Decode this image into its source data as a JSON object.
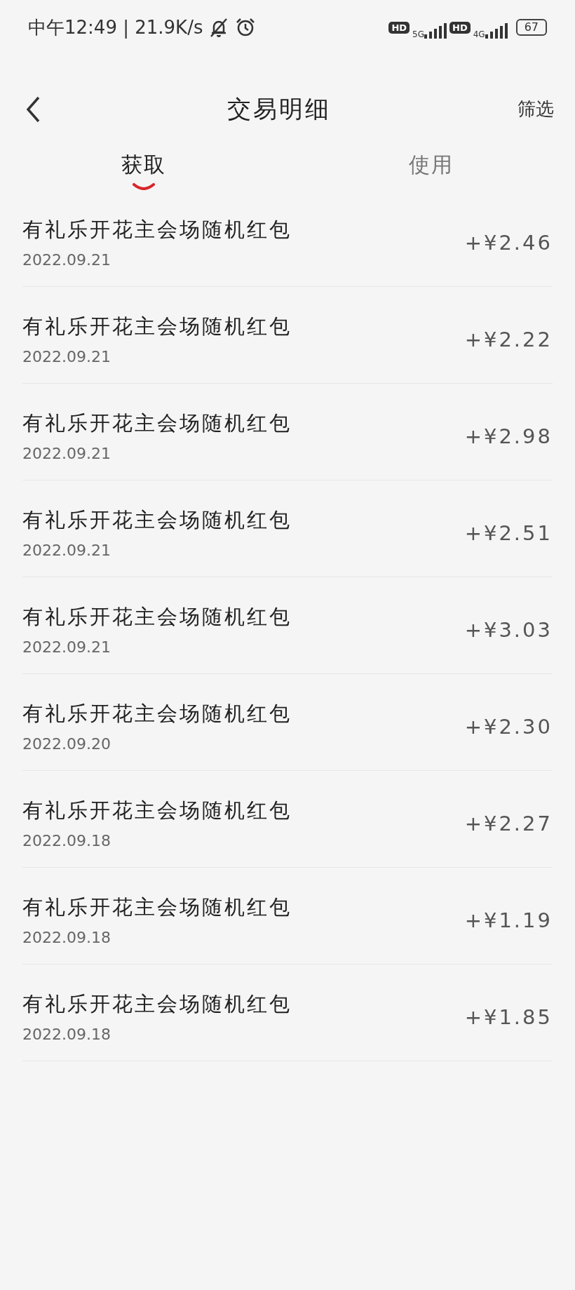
{
  "status_bar": {
    "time": "中午12:49 | 21.9K/s",
    "sim1": {
      "badge": "HD",
      "network": "5G"
    },
    "sim2": {
      "badge": "HD",
      "network": "4G"
    },
    "battery": "67"
  },
  "header": {
    "title": "交易明细",
    "action": "筛选"
  },
  "tabs": [
    {
      "label": "获取",
      "selected": true
    },
    {
      "label": "使用",
      "selected": false
    }
  ],
  "transactions": [
    {
      "title": "有礼乐开花主会场随机红包",
      "date": "2022.09.21",
      "amount": "+¥2.46"
    },
    {
      "title": "有礼乐开花主会场随机红包",
      "date": "2022.09.21",
      "amount": "+¥2.22"
    },
    {
      "title": "有礼乐开花主会场随机红包",
      "date": "2022.09.21",
      "amount": "+¥2.98"
    },
    {
      "title": "有礼乐开花主会场随机红包",
      "date": "2022.09.21",
      "amount": "+¥2.51"
    },
    {
      "title": "有礼乐开花主会场随机红包",
      "date": "2022.09.21",
      "amount": "+¥3.03"
    },
    {
      "title": "有礼乐开花主会场随机红包",
      "date": "2022.09.20",
      "amount": "+¥2.30"
    },
    {
      "title": "有礼乐开花主会场随机红包",
      "date": "2022.09.18",
      "amount": "+¥2.27"
    },
    {
      "title": "有礼乐开花主会场随机红包",
      "date": "2022.09.18",
      "amount": "+¥1.19"
    },
    {
      "title": "有礼乐开花主会场随机红包",
      "date": "2022.09.18",
      "amount": "+¥1.85"
    }
  ]
}
